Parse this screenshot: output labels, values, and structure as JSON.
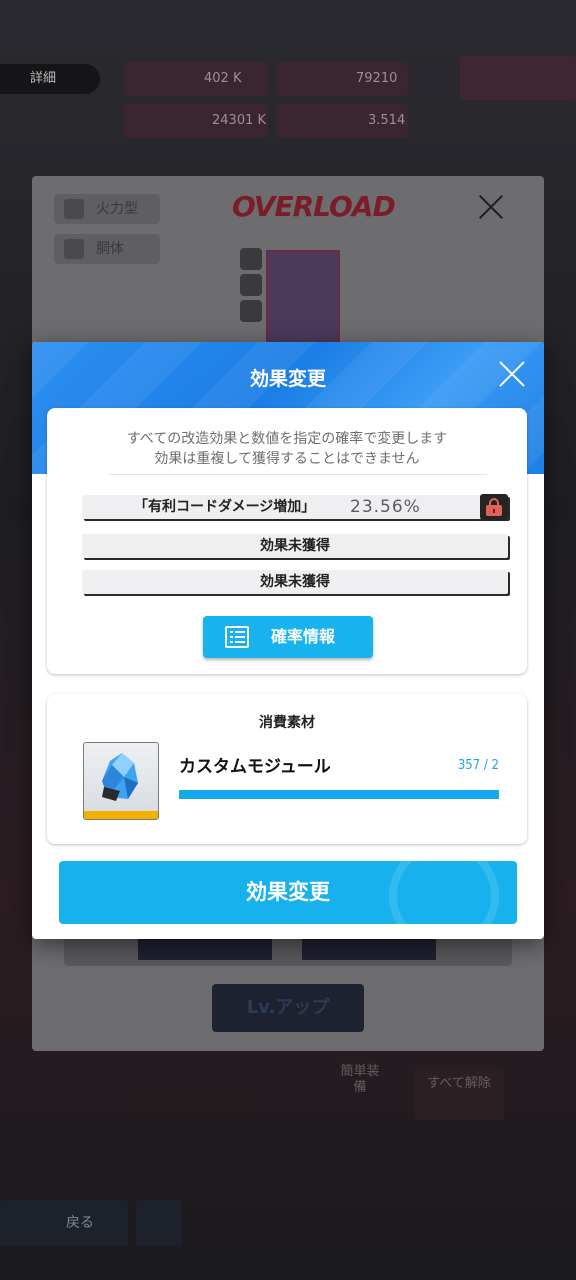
{
  "background": {
    "detail_label": "詳細",
    "stats": [
      "402 K",
      "79210 K",
      "24301 K",
      "3.514"
    ],
    "card": {
      "title": "OVERLOAD",
      "type_chip": "火力型",
      "body_chip": "胴体"
    },
    "lvup_label": "Lv.アップ",
    "side_label_1": "簡単装備",
    "side_label_2": "すべて解除",
    "back_label": "戻る"
  },
  "modal": {
    "title": "効果変更",
    "description_line1": "すべての改造効果と数値を指定の確率で変更します",
    "description_line2": "効果は重複して獲得することはできません",
    "effects": [
      {
        "name": "「有利コードダメージ増加」",
        "value": "23.56%",
        "locked": true
      },
      {
        "name": "効果未獲得"
      },
      {
        "name": "効果未獲得"
      }
    ],
    "rate_button_label": "確率情報",
    "material": {
      "section_title": "消費素材",
      "item_name": "カスタムモジュール",
      "count": "357 / 2",
      "progress": 1.0
    },
    "execute_button_label": "効果変更"
  },
  "colors": {
    "accent_blue": "#17b2ee",
    "header_blue": "#1b7ee6",
    "lock_red": "#e0625a"
  }
}
